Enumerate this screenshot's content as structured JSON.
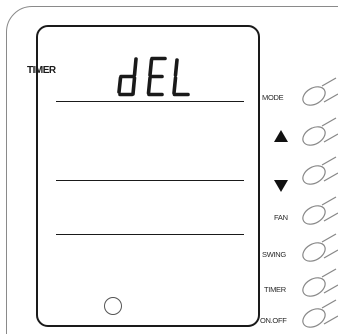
{
  "lcd": {
    "mode_indicator": "TIMER",
    "display_text": "dEL"
  },
  "buttons": [
    {
      "id": "mode",
      "label": "MODE"
    },
    {
      "id": "up",
      "label": "",
      "icon": "up-arrow-icon"
    },
    {
      "id": "down",
      "label": "",
      "icon": "down-arrow-icon"
    },
    {
      "id": "fan",
      "label": "FAN"
    },
    {
      "id": "swing",
      "label": "SWING"
    },
    {
      "id": "timer",
      "label": "TIMER"
    },
    {
      "id": "onoff",
      "label": "ON.OFF"
    }
  ],
  "colors": {
    "lcd_ink": "#1a1a1a",
    "outline": "#8a8a8a",
    "background": "#ffffff"
  }
}
